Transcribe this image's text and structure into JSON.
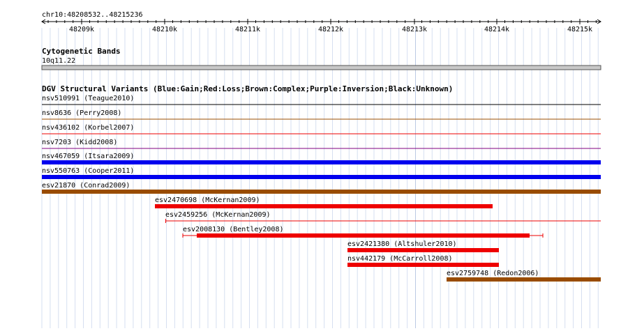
{
  "ruler": {
    "title": "chr10:48208532..48215236",
    "ticks": [
      "48209k",
      "48210k",
      "48211k",
      "48212k",
      "48213k",
      "48214k",
      "48215k"
    ]
  },
  "cytoband": {
    "heading": "Cytogenetic Bands",
    "label": "10q11.22"
  },
  "dgv": {
    "heading": "DGV Structural Variants (Blue:Gain;Red:Loss;Brown:Complex;Purple:Inversion;Black:Unknown)",
    "colors": {
      "Gain": "#0000ee",
      "Loss": "#ee0000",
      "Complex": "#994c00",
      "Inversion": "#800080",
      "Unknown": "#000000"
    },
    "features": [
      {
        "label": "nsv510991 (Teague2010)",
        "type": "Unknown",
        "thin": true
      },
      {
        "label": "nsv8636 (Perry2008)",
        "type": "Complex",
        "thin": true
      },
      {
        "label": "nsv436102 (Korbel2007)",
        "type": "Loss",
        "thin": true
      },
      {
        "label": "nsv7203 (Kidd2008)",
        "type": "Inversion",
        "thin": true
      },
      {
        "label": "nsv467059 (Itsara2009)",
        "type": "Gain"
      },
      {
        "label": "nsv550763 (Cooper2011)",
        "type": "Gain"
      },
      {
        "label": "esv21870 (Conrad2009)",
        "type": "Complex"
      },
      {
        "label": "esv2470698 (McKernan2009)",
        "type": "Loss"
      },
      {
        "label": "esv2459256 (McKernan2009)",
        "type": "Loss",
        "thin": true
      },
      {
        "label": "esv2008130 (Bentley2008)",
        "type": "Loss",
        "whiskers": true
      },
      {
        "label": "esv2421380 (Altshuler2010)",
        "type": "Loss"
      },
      {
        "label": "nsv442179 (McCarroll2008)",
        "type": "Loss"
      },
      {
        "label": "esv2759748 (Redon2006)",
        "type": "Complex"
      }
    ]
  }
}
